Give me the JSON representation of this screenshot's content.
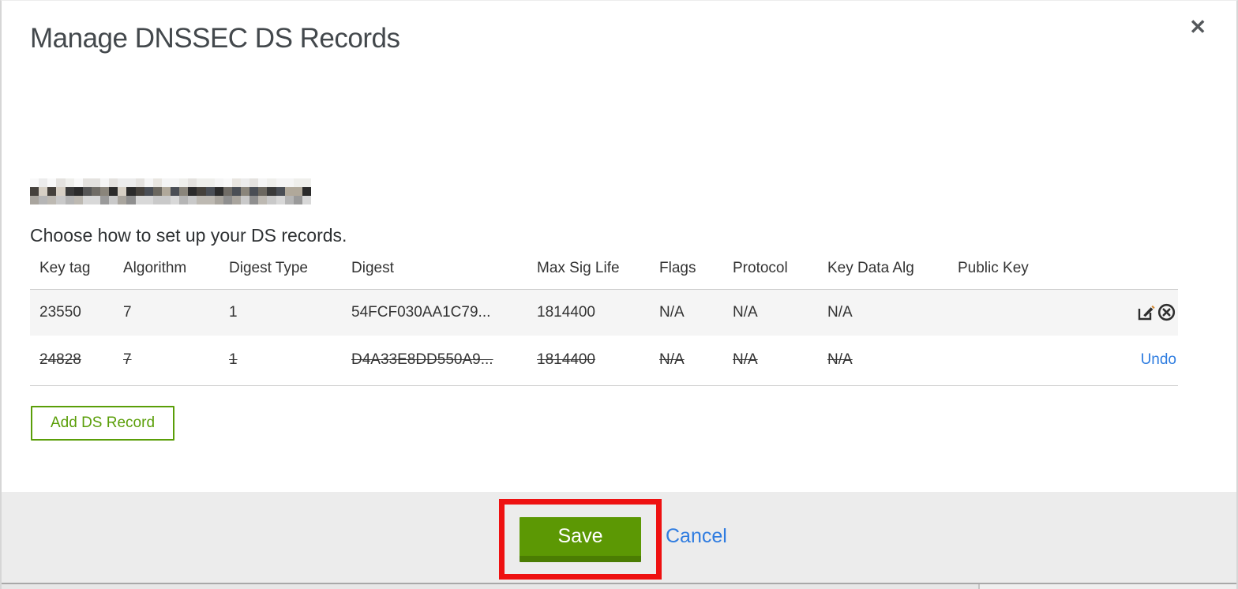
{
  "modal": {
    "title": "Manage DNSSEC DS Records",
    "close_icon": "✕"
  },
  "domain": {
    "redacted": true
  },
  "instructions": "Choose how to set up your DS records.",
  "table": {
    "headers": [
      "Key tag",
      "Algorithm",
      "Digest Type",
      "Digest",
      "Max Sig Life",
      "Flags",
      "Protocol",
      "Key Data Alg",
      "Public Key"
    ],
    "rows": [
      {
        "key_tag": "23550",
        "algorithm": "7",
        "digest_type": "1",
        "digest": "54FCF030AA1C79...",
        "max_sig_life": "1814400",
        "flags": "N/A",
        "protocol": "N/A",
        "key_data_alg": "N/A",
        "public_key": "",
        "state": "normal"
      },
      {
        "key_tag": "24828",
        "algorithm": "7",
        "digest_type": "1",
        "digest": "D4A33E8DD550A9...",
        "max_sig_life": "1814400",
        "flags": "N/A",
        "protocol": "N/A",
        "key_data_alg": "N/A",
        "public_key": "",
        "state": "deleted",
        "undo_label": "Undo"
      }
    ]
  },
  "buttons": {
    "add_record": "Add DS Record",
    "save": "Save",
    "cancel": "Cancel"
  },
  "colors": {
    "accent_green": "#5a9e08",
    "save_green": "#5c9804",
    "save_green_dark": "#4b7d03",
    "annotation_red": "#ee1111",
    "link_blue": "#2d7ce0",
    "row_bg": "#f5f5f5",
    "footer_bg": "#ececec",
    "border_gray": "#cccccc"
  },
  "redacted_mosaic": {
    "cols": 32,
    "rows": 3,
    "palettes": [
      [
        "#f5f5f5",
        "#ececec",
        "#e9e6e1",
        "#f9f9f9",
        "#efefec",
        "#e4e2df"
      ],
      [
        "#3a3a3a",
        "#565656",
        "#6b675f",
        "#2b2b2b",
        "#8a857b",
        "#b0a89a",
        "#4a4e55",
        "#706c66",
        "#d6cfc4",
        "#45413c",
        "#5d6168"
      ],
      [
        "#b5b5b5",
        "#c9c9c9",
        "#8f8f8f",
        "#a9a59e",
        "#d8d8d8",
        "#bdb9b2",
        "#9a9a9a"
      ]
    ]
  }
}
